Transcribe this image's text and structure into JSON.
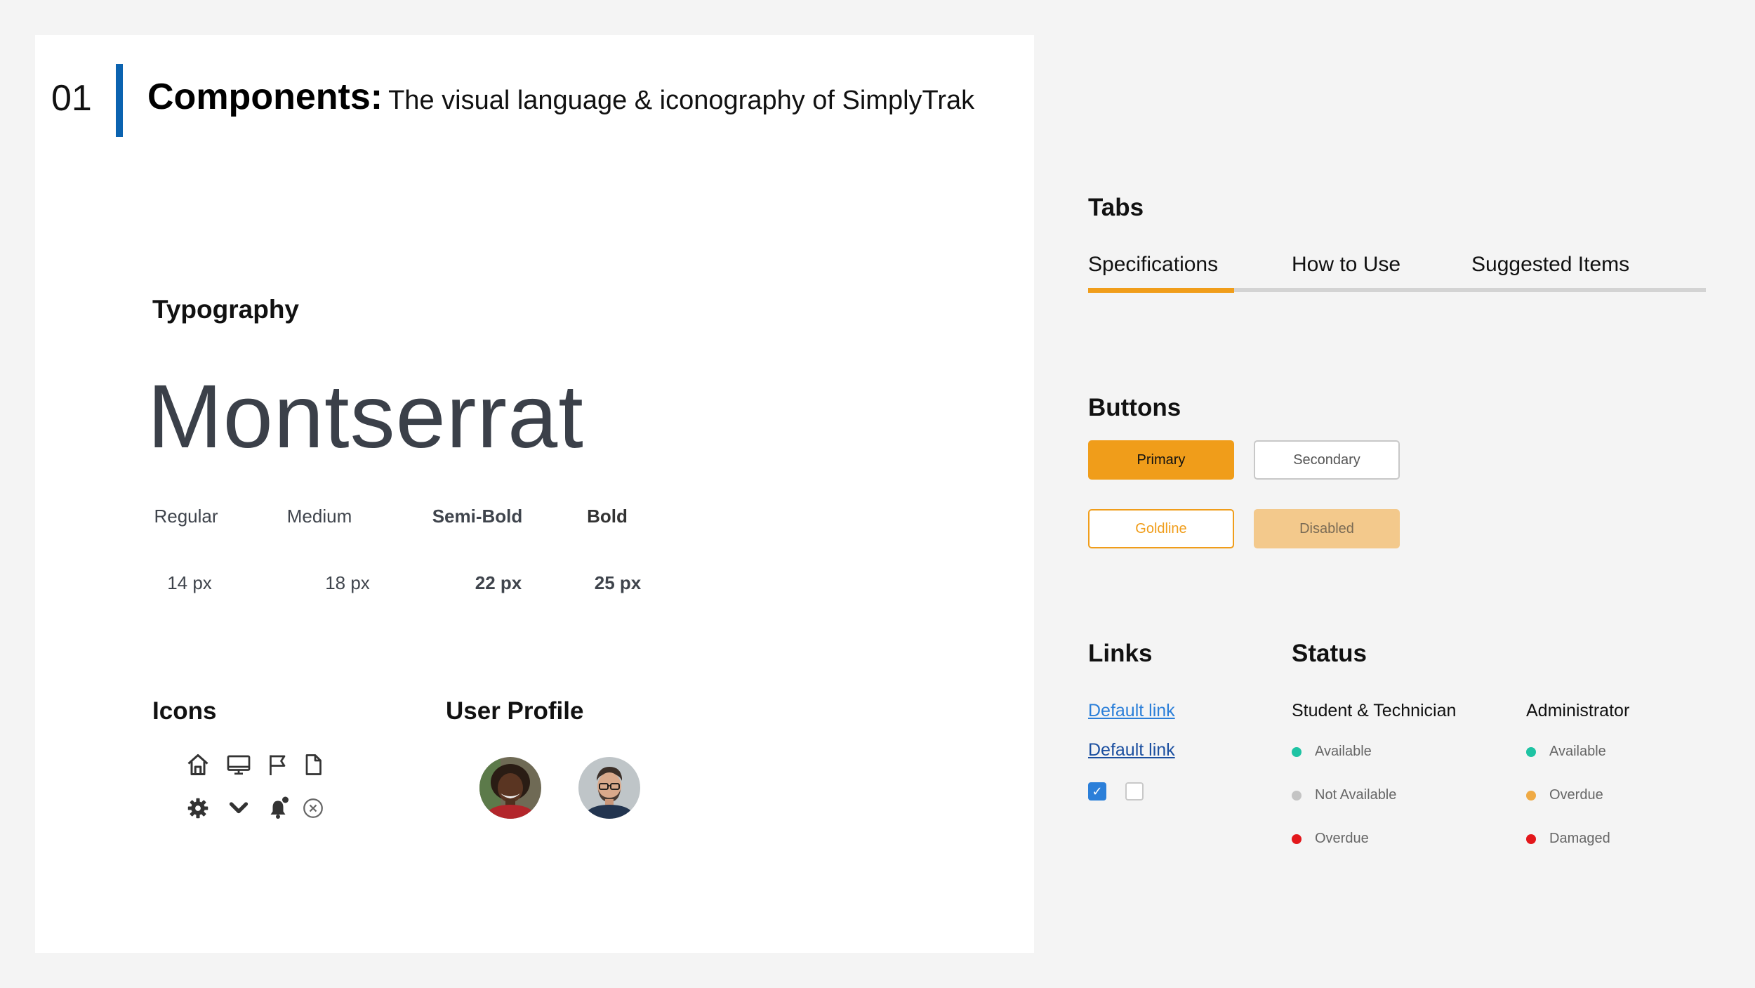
{
  "section": {
    "number": "01",
    "title": "Components:",
    "subtitle": "The visual language & iconography of SimplyTrak",
    "accent": "#0b63b0"
  },
  "typography": {
    "heading": "Typography",
    "font_name": "Montserrat",
    "weights": [
      "Regular",
      "Medium",
      "Semi-Bold",
      "Bold"
    ],
    "sizes": [
      "14 px",
      "18 px",
      "22 px",
      "25 px"
    ]
  },
  "icons": {
    "heading": "Icons",
    "items": [
      "home-icon",
      "monitor-icon",
      "flag-icon",
      "document-icon",
      "gear-icon",
      "chevron-down-icon",
      "notification-bell-icon",
      "close-circle-icon"
    ]
  },
  "user_profile": {
    "heading": "User Profile",
    "avatars": [
      "avatar-woman",
      "avatar-man"
    ]
  },
  "tabs": {
    "heading": "Tabs",
    "items": [
      "Specifications",
      "How to Use",
      "Suggested Items"
    ],
    "active_index": 0,
    "active_color": "#f09d1a"
  },
  "buttons": {
    "heading": "Buttons",
    "primary": "Primary",
    "secondary": "Secondary",
    "goldline": "Goldline",
    "disabled": "Disabled",
    "brand_color": "#f09d1a"
  },
  "links": {
    "heading": "Links",
    "items": [
      "Default link",
      "Default link"
    ],
    "checkbox_checked": true,
    "checkbox_unchecked": false
  },
  "status": {
    "heading": "Status",
    "columns": [
      {
        "title": "Student & Technician",
        "items": [
          {
            "label": "Available",
            "color": "#1ec3a3"
          },
          {
            "label": "Not Available",
            "color": "#c4c4c4"
          },
          {
            "label": "Overdue",
            "color": "#e3171b"
          }
        ]
      },
      {
        "title": "Administrator",
        "items": [
          {
            "label": "Available",
            "color": "#1ec3a3"
          },
          {
            "label": "Overdue",
            "color": "#efaa45"
          },
          {
            "label": "Damaged",
            "color": "#e3171b"
          }
        ]
      }
    ]
  }
}
